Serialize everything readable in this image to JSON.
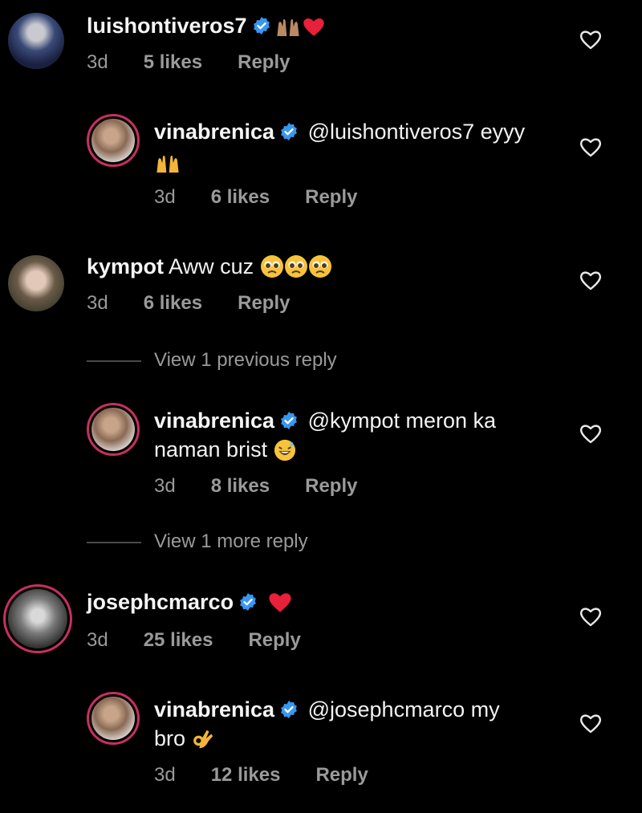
{
  "comments": [
    {
      "username": "luishontiveros7",
      "text": "",
      "time": "3d",
      "likes": "5 likes",
      "reply": "Reply",
      "emojis": [
        "raising-hands-emoji",
        "red-heart-emoji"
      ]
    },
    {
      "username": "vinabrenica",
      "text": "@luishontiveros7 eyyy",
      "time": "3d",
      "likes": "6 likes",
      "reply": "Reply",
      "emojis": [
        "raising-hands-emoji"
      ]
    },
    {
      "username": "kympot",
      "text": "Aww cuz",
      "time": "3d",
      "likes": "6 likes",
      "reply": "Reply",
      "emojis": [
        "pleading-face-emoji",
        "pleading-face-emoji",
        "pleading-face-emoji"
      ]
    },
    {
      "username": "vinabrenica",
      "text_line1": "@kympot meron ka",
      "text_line2": "naman brist",
      "time": "3d",
      "likes": "8 likes",
      "reply": "Reply",
      "emojis": [
        "grinning-sweat-emoji"
      ]
    },
    {
      "username": "josephcmarco",
      "text": "",
      "time": "3d",
      "likes": "25 likes",
      "reply": "Reply",
      "emojis": [
        "red-heart-emoji"
      ]
    },
    {
      "username": "vinabrenica",
      "text_line1": "@josephcmarco my",
      "text_line2": "bro",
      "time": "3d",
      "likes": "12 likes",
      "reply": "Reply",
      "emojis": [
        "ok-hand-emoji"
      ]
    }
  ],
  "view_previous_reply": "View 1 previous reply",
  "view_more_reply": "View 1 more reply",
  "colors": {
    "background": "#000000",
    "verified": "#3897f0",
    "story_ring": "#c7305f",
    "meta_text": "#9a9a9a"
  }
}
